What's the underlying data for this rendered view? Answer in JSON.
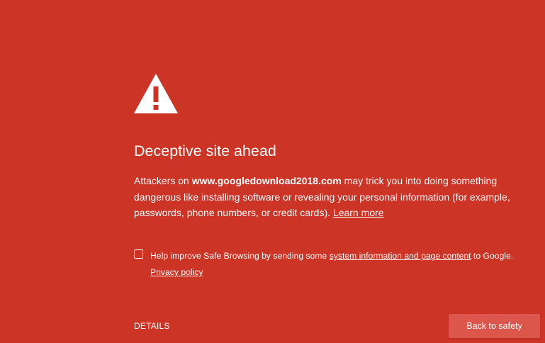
{
  "interstitial": {
    "icon": "warning-triangle-icon",
    "title": "Deceptive site ahead",
    "message": {
      "prefix": "Attackers on ",
      "domain": "www.googledownload2018.com",
      "suffix": " may trick you into doing something dangerous like installing software or revealing your personal information (for example, passwords, phone numbers, or credit cards). ",
      "learn_more": "Learn more"
    },
    "safe_browsing": {
      "checked": false,
      "prefix": "Help improve Safe Browsing by sending some ",
      "link": "system information and page content",
      "suffix": " to Google.",
      "privacy_link": "Privacy policy"
    },
    "details_label": "DETAILS",
    "back_button_label": "Back to safety"
  },
  "colors": {
    "background": "#cc3426",
    "text": "#ffffff",
    "button_background": "#dd564b"
  }
}
